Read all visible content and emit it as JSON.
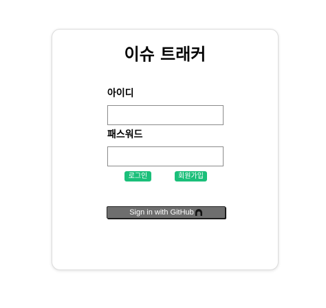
{
  "login_card": {
    "title": "이슈 트래커",
    "id_label": "아이디",
    "id_value": "",
    "password_label": "패스워드",
    "password_value": "",
    "login_button": "로그인",
    "signup_button": "회원가입",
    "github_button": "Sign in with GitHub",
    "github_icon": "github-icon"
  },
  "colors": {
    "accent_green": "#1bbf7a",
    "github_button_bg": "#6e6e6e"
  }
}
